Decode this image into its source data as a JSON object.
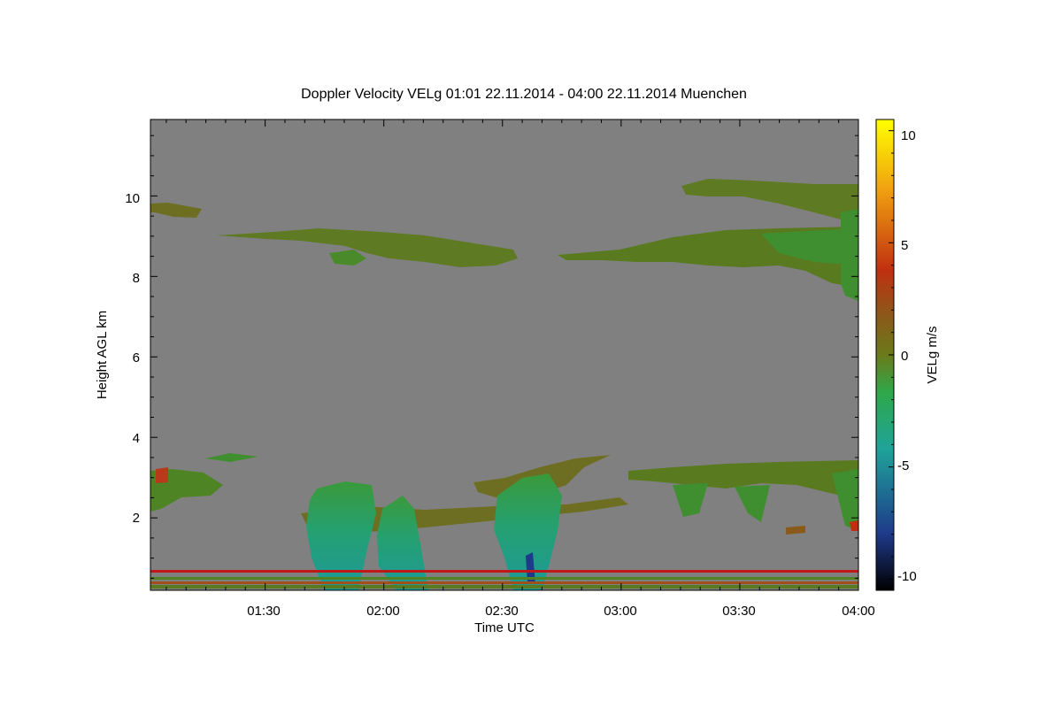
{
  "chart_data": {
    "type": "heatmap",
    "title": "Doppler Velocity VELg   01:01 22.11.2014 - 04:00 22.11.2014 Muenchen",
    "xlabel": "Time UTC",
    "ylabel": "Height AGL km",
    "colorbar_label": "VELg m/s",
    "x_ticks": [
      "01:30",
      "02:00",
      "02:30",
      "03:00",
      "03:30",
      "04:00"
    ],
    "y_ticks": [
      "2",
      "4",
      "6",
      "8",
      "10"
    ],
    "colorbar_ticks": [
      "10",
      "5",
      "0",
      "-5",
      "-10"
    ],
    "xlim": [
      "01:01",
      "04:00"
    ],
    "ylim": [
      0.2,
      11.9
    ],
    "clim": [
      -10.5,
      10.5
    ],
    "background_color": "#808080",
    "colormap": [
      "#000000",
      "#1e3a8a",
      "#1fa39a",
      "#2ea84a",
      "#4d8a1a",
      "#8a5a1a",
      "#c03010",
      "#f0a010",
      "#ffff00"
    ],
    "features": [
      {
        "name": "upper cirrus band",
        "time": [
          "01:01",
          "04:00"
        ],
        "height_km": [
          7.6,
          10.5
        ],
        "velocity_ms": [
          -1.5,
          0.5
        ]
      },
      {
        "name": "mid-level cloud layer",
        "time": [
          "01:01",
          "04:00"
        ],
        "height_km": [
          1.5,
          3.6
        ],
        "velocity_ms": [
          -2,
          1
        ]
      },
      {
        "name": "precipitation fallstreak 1",
        "time": [
          "01:41",
          "01:56"
        ],
        "height_km": [
          0.2,
          2.9
        ],
        "velocity_ms": [
          -4,
          -1.5
        ]
      },
      {
        "name": "precipitation fallstreak 2",
        "time": [
          "02:31",
          "02:45"
        ],
        "height_km": [
          0.2,
          3.4
        ],
        "velocity_ms": [
          -6,
          -1.5
        ]
      },
      {
        "name": "near-surface layer",
        "time": [
          "01:01",
          "04:00"
        ],
        "height_km": [
          0.2,
          0.7
        ],
        "velocity_ms": [
          -1,
          3
        ]
      }
    ]
  }
}
